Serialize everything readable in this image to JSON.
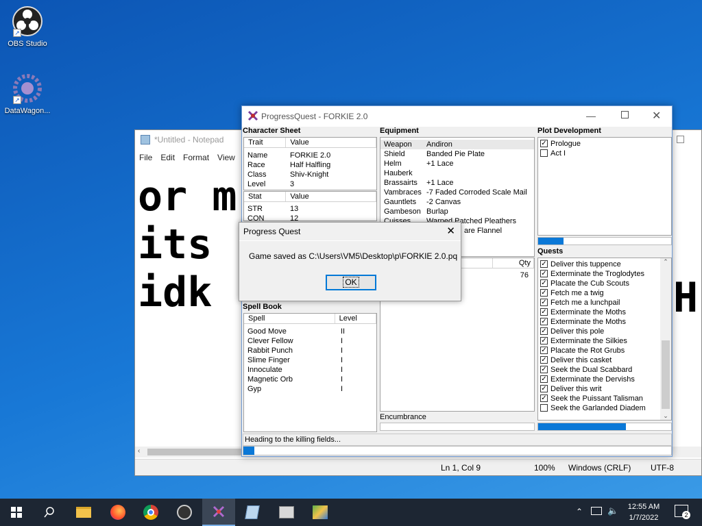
{
  "desktop": {
    "icons": [
      {
        "label": "OBS Studio"
      },
      {
        "label": "DataWagon..."
      }
    ]
  },
  "notepad": {
    "title": "*Untitled - Notepad",
    "menu": [
      "File",
      "Edit",
      "Format",
      "View"
    ],
    "text_lines": [
      "or m",
      "its",
      "idk"
    ],
    "text_overflow_right": "H",
    "status": {
      "position": "Ln 1, Col 9",
      "zoom": "100%",
      "line_ending": "Windows (CRLF)",
      "encoding": "UTF-8"
    }
  },
  "pq": {
    "title": "ProgressQuest - FORKIE 2.0",
    "character_sheet": {
      "heading": "Character Sheet",
      "trait_headers": [
        "Trait",
        "Value"
      ],
      "traits": [
        [
          "Name",
          "FORKIE 2.0"
        ],
        [
          "Race",
          "Half Halfling"
        ],
        [
          "Class",
          "Shiv-Knight"
        ],
        [
          "Level",
          "3"
        ]
      ],
      "stat_headers": [
        "Stat",
        "Value"
      ],
      "stats": [
        [
          "STR",
          "13"
        ],
        [
          "CON",
          "12"
        ]
      ]
    },
    "spell_book": {
      "heading": "Spell Book",
      "headers": [
        "Spell",
        "Level"
      ],
      "spells": [
        [
          "Good Move",
          "II"
        ],
        [
          "Clever Fellow",
          "I"
        ],
        [
          "Rabbit Punch",
          "I"
        ],
        [
          "Slime Finger",
          "I"
        ],
        [
          "Innoculate",
          "I"
        ],
        [
          "Magnetic Orb",
          "I"
        ],
        [
          "Gyp",
          "I"
        ]
      ]
    },
    "equipment": {
      "heading": "Equipment",
      "items": [
        [
          "Weapon",
          "Andiron"
        ],
        [
          "Shield",
          "Banded Pie Plate"
        ],
        [
          "Helm",
          "+1 Lace"
        ],
        [
          "Hauberk",
          ""
        ],
        [
          "Brassairts",
          "+1 Lace"
        ],
        [
          "Vambraces",
          "-7 Faded Corroded Scale Mail"
        ],
        [
          "Gauntlets",
          "-2 Canvas"
        ],
        [
          "Gambeson",
          "Burlap"
        ],
        [
          "Cuisses",
          "Warped Patched Pleathers"
        ]
      ],
      "partial_item": "are Flannel",
      "inventory_qty_header": "Qty",
      "inventory_qty": "76",
      "encumbrance_label": "Encumbrance"
    },
    "plot": {
      "heading": "Plot Development",
      "items": [
        {
          "label": "Prologue",
          "checked": true
        },
        {
          "label": "Act I",
          "checked": false
        }
      ],
      "progress": 0.19
    },
    "quests": {
      "heading": "Quests",
      "items": [
        {
          "label": "Deliver this tuppence",
          "checked": true
        },
        {
          "label": "Exterminate the Troglodytes",
          "checked": true
        },
        {
          "label": "Placate the Cub Scouts",
          "checked": true
        },
        {
          "label": "Fetch me a twig",
          "checked": true
        },
        {
          "label": "Fetch me a lunchpail",
          "checked": true
        },
        {
          "label": "Exterminate the Moths",
          "checked": true
        },
        {
          "label": "Exterminate the Moths",
          "checked": true
        },
        {
          "label": "Deliver this pole",
          "checked": true
        },
        {
          "label": "Exterminate the Silkies",
          "checked": true
        },
        {
          "label": "Placate the Rot Grubs",
          "checked": true
        },
        {
          "label": "Deliver this casket",
          "checked": true
        },
        {
          "label": "Seek the Dual Scabbard",
          "checked": true
        },
        {
          "label": "Exterminate the Dervishs",
          "checked": true
        },
        {
          "label": "Deliver this writ",
          "checked": true
        },
        {
          "label": "Seek the Puissant Talisman",
          "checked": true
        },
        {
          "label": "Seek the Garlanded Diadem",
          "checked": false
        }
      ],
      "progress": 0.66
    },
    "status_text": "Heading to the killing fields...",
    "task_progress": 0.025
  },
  "dialog": {
    "title": "Progress Quest",
    "message": "Game saved as C:\\Users\\VM5\\Desktop\\p\\FORKIE 2.0.pq",
    "ok_label": "OK"
  },
  "taskbar": {
    "time": "12:55 AM",
    "date": "1/7/2022",
    "notification_count": "2"
  },
  "colors": {
    "accent": "#0078d7",
    "progress": "#0b78d7",
    "taskbar": "#1d2633"
  }
}
